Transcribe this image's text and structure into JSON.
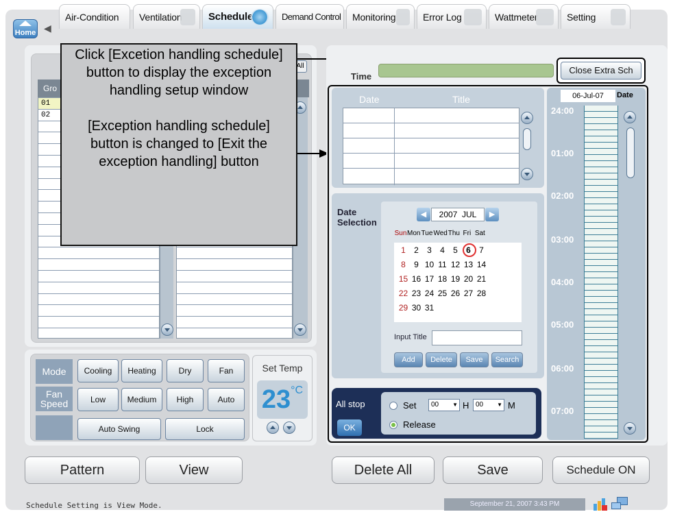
{
  "tabs": {
    "home": "Home",
    "items": [
      "Air-Condition",
      "Ventilation",
      "Schedule",
      "Demand Control",
      "Monitoring",
      "Error Log",
      "Wattmeter",
      "Setting"
    ]
  },
  "callout": {
    "line1": "Click [Excetion handling schedule] button to display the exception handling setup window",
    "line2": "[Exception handling schedule] button is changed to [Exit the exception handling] button"
  },
  "left": {
    "all_label": "All",
    "group_header": "Gro",
    "groups": [
      "01",
      "02"
    ]
  },
  "mode": {
    "mode_label": "Mode",
    "mode_buttons": [
      "Cooling",
      "Heating",
      "Dry",
      "Fan"
    ],
    "fan_label": "Fan Speed",
    "fan_buttons": [
      "Low",
      "Medium",
      "High",
      "Auto"
    ],
    "swing_button": "Auto Swing",
    "lock_button": "Lock",
    "set_temp_label": "Set Temp",
    "temp_value": "23",
    "temp_unit": "°C"
  },
  "right": {
    "time_label": "Time",
    "close_button": "Close Extra Sch",
    "date_col": "Date",
    "title_col": "Title",
    "current_date": "06-Jul-07",
    "date_button": "Date",
    "date_selection_label": "Date Selection",
    "year": "2007",
    "month": "JUL",
    "weekdays": [
      "Sun",
      "Mon",
      "Tue",
      "Wed",
      "Thu",
      "Fri",
      "Sat"
    ],
    "weeks": [
      [
        "",
        "",
        "",
        "",
        "",
        "",
        ""
      ],
      [
        "1",
        "2",
        "3",
        "4",
        "5",
        "6",
        "7"
      ],
      [
        "8",
        "9",
        "10",
        "11",
        "12",
        "13",
        "14"
      ],
      [
        "15",
        "16",
        "17",
        "18",
        "19",
        "20",
        "21"
      ],
      [
        "22",
        "23",
        "24",
        "25",
        "26",
        "27",
        "28"
      ],
      [
        "29",
        "30",
        "31",
        "",
        "",
        "",
        ""
      ]
    ],
    "selected_day": "6",
    "input_title_label": "Input Title",
    "cal_buttons": [
      "Add",
      "Delete",
      "Save",
      "Search"
    ],
    "all_stop_label": "All stop",
    "ok_label": "OK",
    "set_label": "Set",
    "hour_value": "00",
    "h_label": "H",
    "min_value": "00",
    "m_label": "M",
    "release_label": "Release",
    "hours": [
      "24:00",
      "01:00",
      "02:00",
      "03:00",
      "04:00",
      "05:00",
      "06:00",
      "07:00"
    ]
  },
  "bottom": {
    "pattern": "Pattern",
    "view": "View",
    "delete_all": "Delete All",
    "save": "Save",
    "schedule_on": "Schedule ON"
  },
  "status": {
    "message": "Schedule Setting is View Mode.",
    "datetime": "September 21, 2007 3:43 PM"
  },
  "colors": {
    "accent": "#2e8fd0",
    "panel": "#c5d1dc",
    "green_bar": "#a8c690"
  }
}
